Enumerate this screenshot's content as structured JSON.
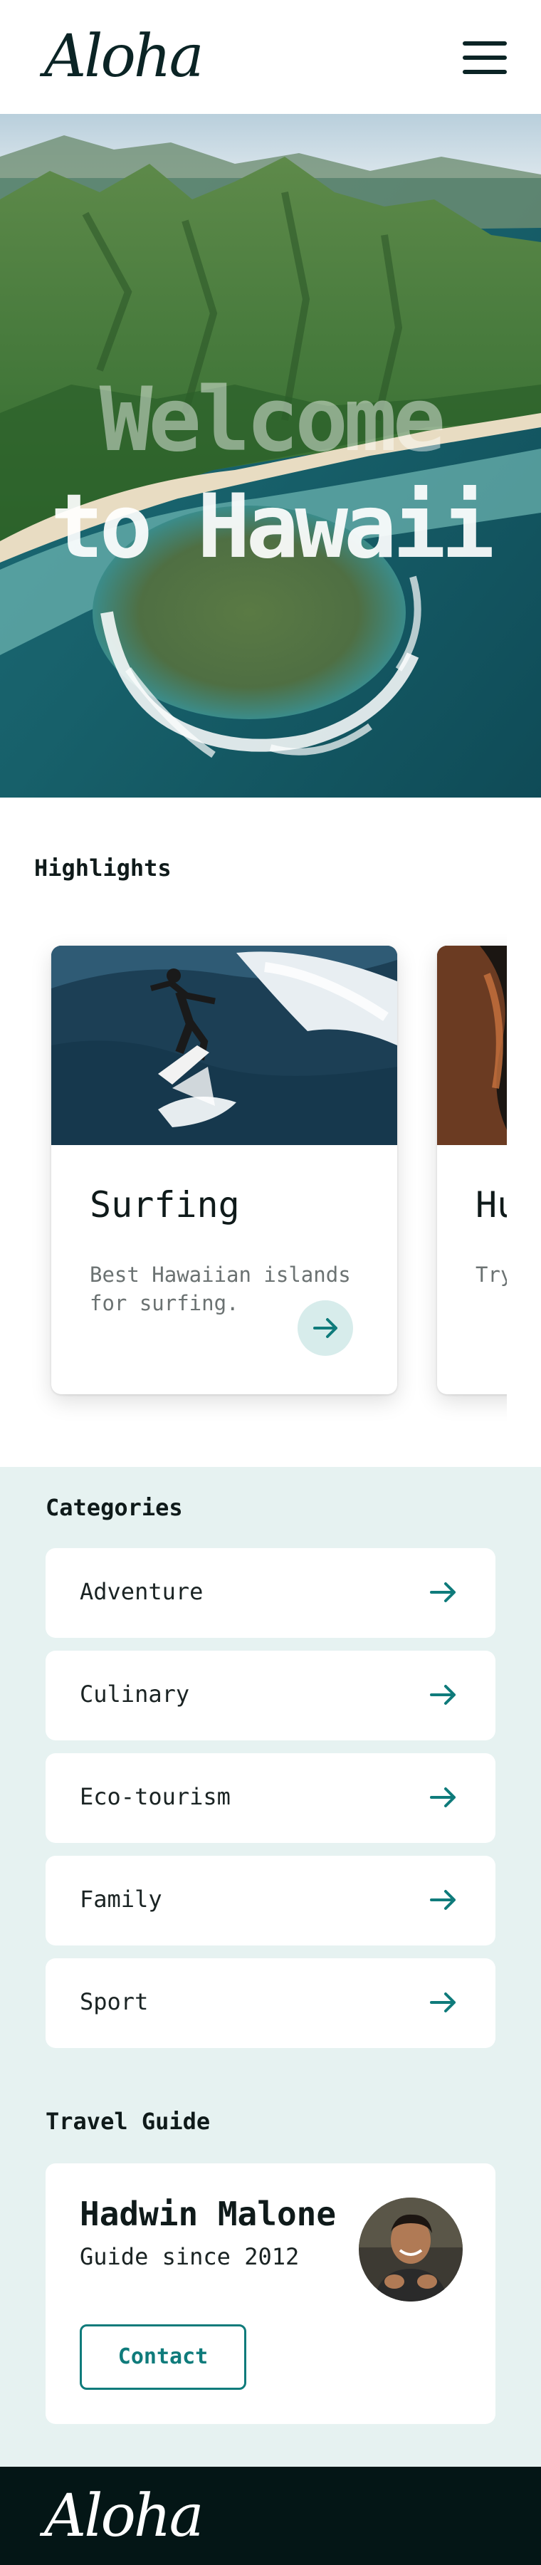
{
  "header": {
    "logo": "Aloha",
    "menu_icon": "hamburger-menu-icon"
  },
  "hero": {
    "title_line1": "Welcome",
    "title_line2": "to Hawaii"
  },
  "highlights": {
    "heading": "Highlights",
    "cards": [
      {
        "title": "Surfing",
        "description": "Best Hawaiian islands for surfing.",
        "action_icon": "arrow-right-icon"
      },
      {
        "title": "Hu",
        "description": "Try",
        "action_icon": "arrow-right-icon"
      }
    ]
  },
  "categories": {
    "heading": "Categories",
    "items": [
      {
        "label": "Adventure",
        "icon": "arrow-right-icon"
      },
      {
        "label": "Culinary",
        "icon": "arrow-right-icon"
      },
      {
        "label": "Eco-tourism",
        "icon": "arrow-right-icon"
      },
      {
        "label": "Family",
        "icon": "arrow-right-icon"
      },
      {
        "label": "Sport",
        "icon": "arrow-right-icon"
      }
    ]
  },
  "guide": {
    "heading": "Travel Guide",
    "name": "Hadwin Malone",
    "since": "Guide since 2012",
    "contact_label": "Contact"
  },
  "footer": {
    "logo": "Aloha"
  },
  "colors": {
    "accent": "#0f7b7b",
    "accent_light": "#d7eceb",
    "section_bg": "#e6f2f1",
    "footer_bg": "#041616",
    "text_dark": "#0f1a1a",
    "text_muted": "#6b7272"
  }
}
